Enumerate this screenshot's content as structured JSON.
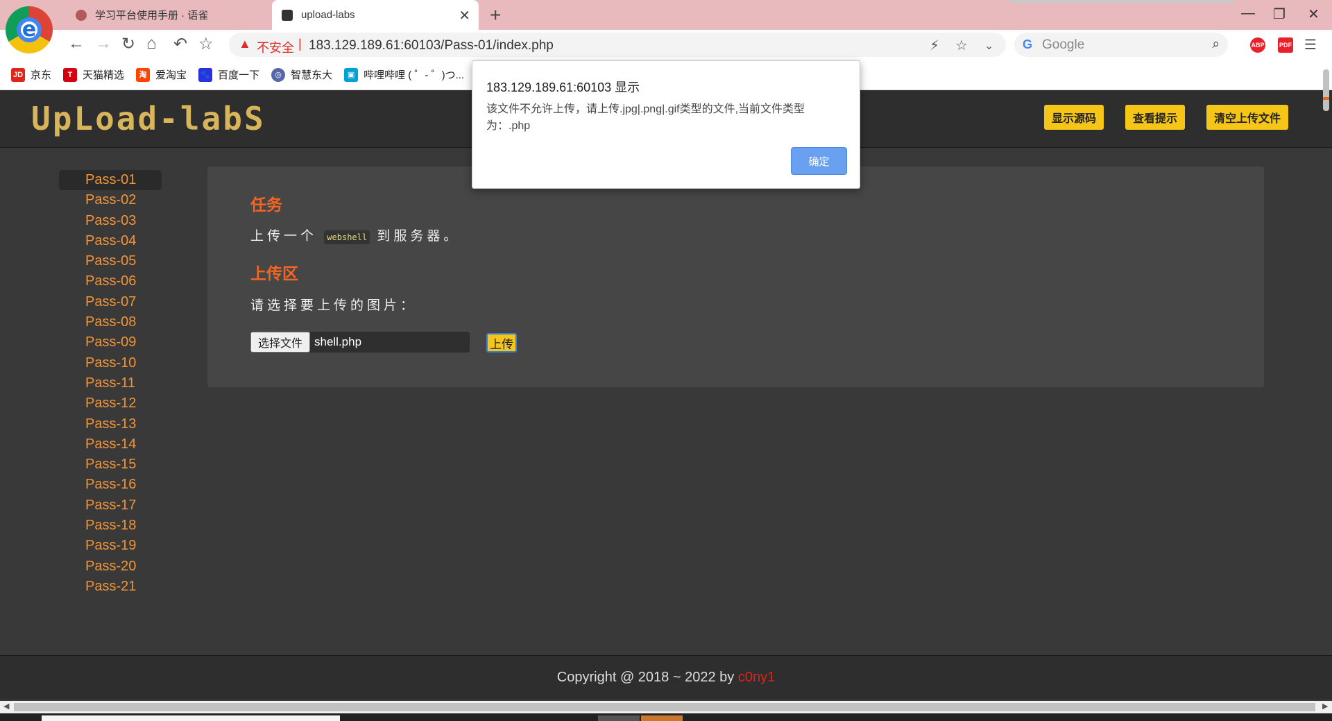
{
  "browser": {
    "tabs": [
      {
        "title": "学习平台使用手册 · 语雀",
        "active": false
      },
      {
        "title": "upload-labs",
        "active": true
      }
    ],
    "new_tab_symbol": "+",
    "close_symbol": "✕",
    "window_controls": [
      "—",
      "❐",
      "✕"
    ],
    "address": {
      "security_label": "不安全",
      "separator": "|",
      "url": "183.129.189.61:60103/Pass-01/index.php"
    },
    "search": {
      "placeholder": "Google",
      "engine_logo": "G"
    },
    "extensions": [
      {
        "label": "ABP",
        "color": "#e8202a"
      },
      {
        "label": "PDF",
        "color": "#e8202a"
      }
    ],
    "menu_symbol": "☰",
    "bookmarks": [
      {
        "label": "京东",
        "icon_text": "JD",
        "color": "#e1251b"
      },
      {
        "label": "天猫精选",
        "icon_text": "T",
        "color": "#d6000f"
      },
      {
        "label": "爱淘宝",
        "icon_text": "淘",
        "color": "#ff4400"
      },
      {
        "label": "百度一下",
        "icon_text": "🐾",
        "color": "#2932e1"
      },
      {
        "label": "智慧东大",
        "icon_text": "◎",
        "color": "#5566aa"
      },
      {
        "label": "哔哩哔哩 ( ゜- ゜)つ...",
        "icon_text": "▣",
        "color": "#00a1d6"
      }
    ]
  },
  "site": {
    "logo": "UpLoad-labS",
    "header_buttons": [
      "显示源码",
      "查看提示",
      "清空上传文件"
    ],
    "sidebar": {
      "active": "Pass-01",
      "items": [
        "Pass-01",
        "Pass-02",
        "Pass-03",
        "Pass-04",
        "Pass-05",
        "Pass-06",
        "Pass-07",
        "Pass-08",
        "Pass-09",
        "Pass-10",
        "Pass-11",
        "Pass-12",
        "Pass-13",
        "Pass-14",
        "Pass-15",
        "Pass-16",
        "Pass-17",
        "Pass-18",
        "Pass-19",
        "Pass-20",
        "Pass-21"
      ]
    },
    "task": {
      "heading": "任务",
      "text_before": "上传一个",
      "code": "webshell",
      "text_after": "到服务器。"
    },
    "upload": {
      "heading": "上传区",
      "prompt": "请选择要上传的图片：",
      "choose_file_label": "选择文件",
      "file_name": "shell.php",
      "submit_label": "上传"
    },
    "footer": {
      "text": "Copyright @ 2018 ~ 2022 by ",
      "author": "c0ny1"
    }
  },
  "dialog": {
    "title": "183.129.189.61:60103 显示",
    "message": "该文件不允许上传，请上传.jpg|.png|.gif类型的文件,当前文件类型为：.php",
    "ok_label": "确定"
  }
}
